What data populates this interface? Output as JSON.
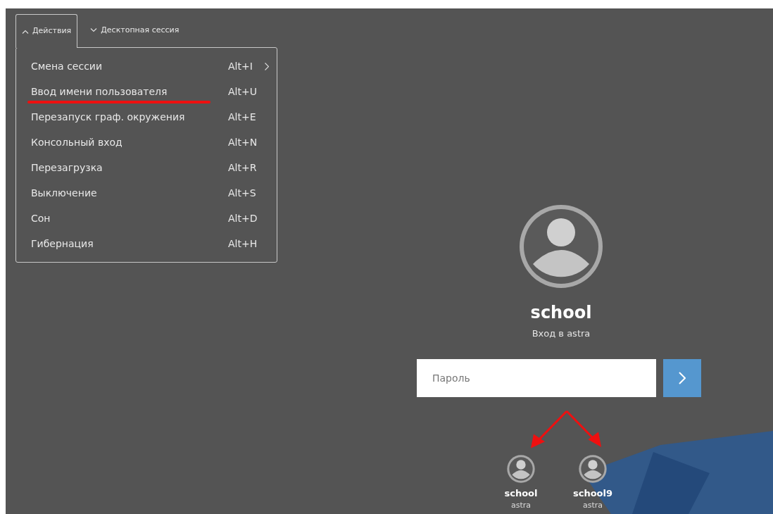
{
  "top_bar": {
    "tabs": [
      {
        "label": "Действия",
        "expanded": true
      },
      {
        "label": "Десктопная сессия",
        "expanded": false
      }
    ]
  },
  "menu": {
    "items": [
      {
        "label": "Смена сессии",
        "shortcut": "Alt+I",
        "submenu": true,
        "underlined": false
      },
      {
        "label": "Ввод имени пользователя",
        "shortcut": "Alt+U",
        "submenu": false,
        "underlined": true
      },
      {
        "label": "Перезапуск граф. окружения",
        "shortcut": "Alt+E",
        "submenu": false,
        "underlined": false
      },
      {
        "label": "Консольный вход",
        "shortcut": "Alt+N",
        "submenu": false,
        "underlined": false
      },
      {
        "label": "Перезагрузка",
        "shortcut": "Alt+R",
        "submenu": false,
        "underlined": false
      },
      {
        "label": "Выключение",
        "shortcut": "Alt+S",
        "submenu": false,
        "underlined": false
      },
      {
        "label": "Сон",
        "shortcut": "Alt+D",
        "submenu": false,
        "underlined": false
      },
      {
        "label": "Гибернация",
        "shortcut": "Alt+H",
        "submenu": false,
        "underlined": false
      }
    ]
  },
  "login": {
    "user": "school",
    "subtitle": "Вход в astra",
    "password": {
      "placeholder": "Пароль"
    },
    "users": [
      {
        "name": "school",
        "host": "astra"
      },
      {
        "name": "school9",
        "host": "astra"
      }
    ]
  }
}
